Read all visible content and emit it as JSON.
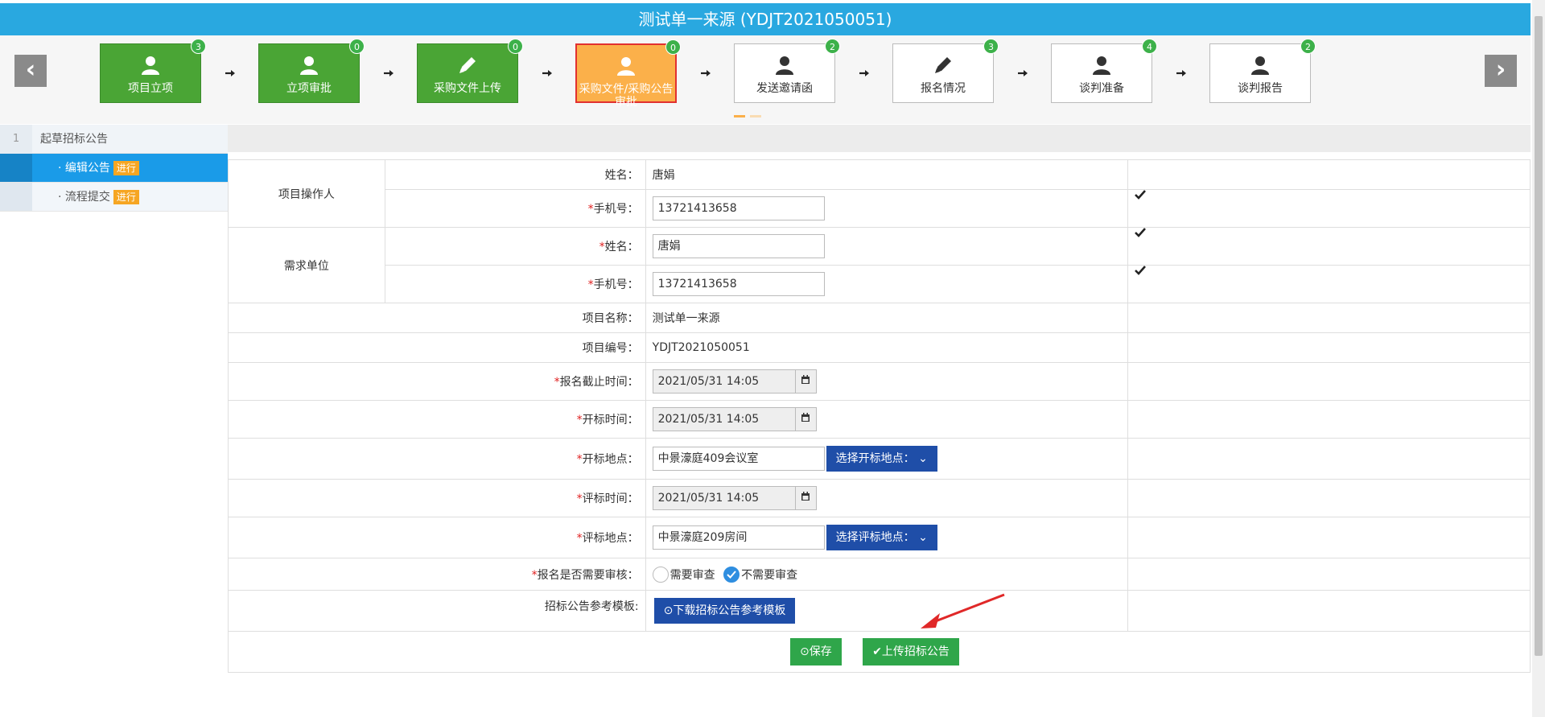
{
  "header": {
    "title": "测试单一来源 (YDJT2021050051)"
  },
  "nav": {
    "prev_label": "‹",
    "next_label": "›"
  },
  "steps": [
    {
      "label": "项目立项",
      "count": "3",
      "state": "done",
      "icon": "user-icon"
    },
    {
      "label": "立项审批",
      "count": "0",
      "state": "done",
      "icon": "user-icon"
    },
    {
      "label": "采购文件上传",
      "count": "0",
      "state": "done",
      "icon": "pencil-icon"
    },
    {
      "label": "采购文件/采购公告审批",
      "count": "0",
      "state": "active",
      "icon": "user-icon"
    },
    {
      "label": "发送邀请函",
      "count": "2",
      "state": "pending",
      "icon": "user-icon"
    },
    {
      "label": "报名情况",
      "count": "3",
      "state": "pending",
      "icon": "pencil-icon"
    },
    {
      "label": "谈判准备",
      "count": "4",
      "state": "pending",
      "icon": "user-icon"
    },
    {
      "label": "谈判报告",
      "count": "2",
      "state": "pending",
      "icon": "user-icon"
    }
  ],
  "sidebar": {
    "section_number": "1",
    "section_title": "起草招标公告",
    "items": [
      {
        "label": "· 编辑公告",
        "tag": "进行",
        "active": true
      },
      {
        "label": "· 流程提交",
        "tag": "进行",
        "active": false
      }
    ]
  },
  "form": {
    "operator_group": "项目操作人",
    "operator_name_label": "姓名：",
    "operator_name": "唐娟",
    "operator_phone_label": "手机号：",
    "operator_phone": "13721413658",
    "demand_group": "需求单位",
    "demand_name_label": "姓名：",
    "demand_name": "唐娟",
    "demand_phone_label": "手机号：",
    "demand_phone": "13721413658",
    "project_name_label": "项目名称：",
    "project_name": "测试单一来源",
    "project_code_label": "项目编号：",
    "project_code": "YDJT2021050051",
    "signup_deadline_label": "报名截止时间：",
    "signup_deadline": "2021/05/31 14:05",
    "open_time_label": "开标时间：",
    "open_time": "2021/05/31 14:05",
    "open_place_label": "开标地点：",
    "open_place": "中景濠庭409会议室",
    "open_place_button": "选择开标地点：",
    "eval_time_label": "评标时间：",
    "eval_time": "2021/05/31 14:05",
    "eval_place_label": "评标地点：",
    "eval_place": "中景濠庭209房间",
    "eval_place_button": "选择评标地点：",
    "review_label": "报名是否需要审核：",
    "review_option_yes": "需要审查",
    "review_option_no": "不需要审查",
    "review_selected": "不需要审查",
    "template_label": "招标公告参考模板:",
    "template_button": "下载招标公告参考模板"
  },
  "actions": {
    "save_label": "保存",
    "upload_label": "上传招标公告"
  },
  "colors": {
    "title_bar": "#29a8e0",
    "step_done": "#4aa535",
    "step_active": "#fbb04a",
    "primary_button": "#1f4ea8",
    "success_button": "#2fa64a",
    "annotation_arrow": "#e02828"
  }
}
